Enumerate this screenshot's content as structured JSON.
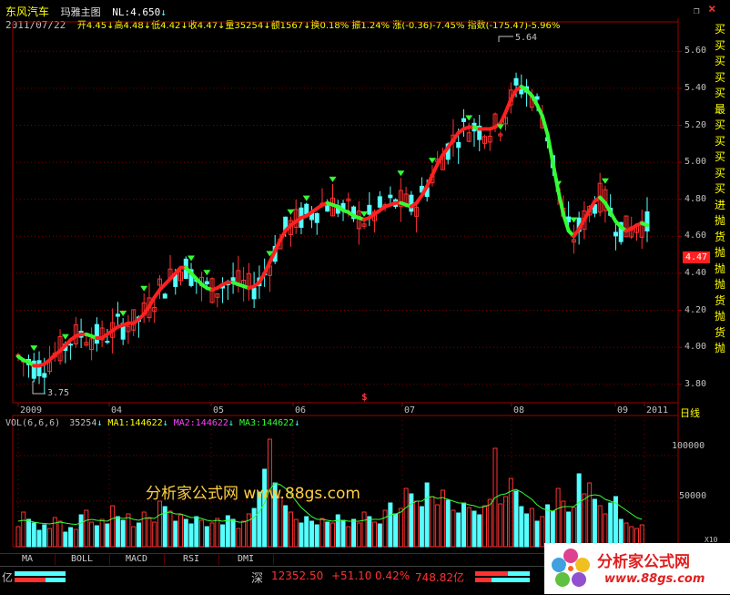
{
  "window": {
    "close_glyph": "×",
    "restore_glyph": "❐"
  },
  "header": {
    "stock_name": "东风汽车",
    "indicator_name": "玛雅主图",
    "nl_value": "NL:4.650",
    "date": "2011/07/22",
    "quote_line": "开4.45↓高4.48↓低4.42↓收4.47↓量35254↓额1567↓换0.18% 振1.24% 涨(-0.36)-7.45% 指数(-175.47)-5.96%"
  },
  "price_axis": {
    "ticks": [
      "5.60",
      "5.40",
      "5.20",
      "5.00",
      "4.80",
      "4.60",
      "4.40",
      "4.20",
      "4.00",
      "3.80"
    ],
    "current_price": "4.47"
  },
  "annotations": {
    "high_label": "5.64",
    "low_label": "3.75",
    "dollar_marker": "$"
  },
  "time_axis": {
    "labels": [
      "2009",
      "04",
      "05",
      "06",
      "07",
      "08",
      "09",
      "2011"
    ],
    "period_button": "日线"
  },
  "right_panel_text": "买买买买买最买买买买买进抛货抛抛抛货抛货抛",
  "volume_header": {
    "vol_label": "VOL(6,6,6)",
    "vol_value": "35254",
    "ma1": "MA1:144622",
    "ma2": "MA2:144622",
    "ma3": "MA3:144622"
  },
  "volume_axis": {
    "ticks": [
      "100000",
      "50000"
    ],
    "unit": "X10"
  },
  "watermark": {
    "text": "分析家公式网 www.88gs.com",
    "logo_cn": "分析家公式网",
    "logo_url": "www.88gs.com"
  },
  "tabs": [
    "MA",
    "BOLL",
    "MACD",
    "RSI",
    "DMI"
  ],
  "status_bar": {
    "left_label": "亿",
    "index_name": "深",
    "index_value": "12352.50",
    "index_change": "+51.10",
    "index_pct": "0.42%",
    "turnover": "748.82亿"
  },
  "colors": {
    "up": "#ff3232",
    "down": "#54ffff",
    "ma_up": "#ff2020",
    "ma_down": "#33ff33",
    "grid": "#800000",
    "text_yellow": "#ffff00",
    "text_cyan": "#54ffff",
    "text_magenta": "#ff44ff",
    "watermark": "#ffd040"
  },
  "chart_data": {
    "type": "candlestick",
    "ylim": [
      3.7,
      5.7
    ],
    "volume_ylim": [
      0,
      130000
    ],
    "ma_line": [
      3.95,
      3.93,
      3.92,
      3.9,
      3.9,
      3.91,
      3.93,
      3.96,
      3.98,
      4.01,
      4.04,
      4.06,
      4.07,
      4.07,
      4.06,
      4.05,
      4.05,
      4.07,
      4.09,
      4.11,
      4.12,
      4.13,
      4.13,
      4.15,
      4.18,
      4.22,
      4.27,
      4.31,
      4.34,
      4.37,
      4.4,
      4.43,
      4.43,
      4.4,
      4.37,
      4.34,
      4.32,
      4.31,
      4.32,
      4.34,
      4.35,
      4.35,
      4.34,
      4.33,
      4.32,
      4.33,
      4.35,
      4.4,
      4.46,
      4.52,
      4.58,
      4.63,
      4.66,
      4.68,
      4.7,
      4.71,
      4.73,
      4.75,
      4.77,
      4.78,
      4.77,
      4.76,
      4.74,
      4.73,
      4.71,
      4.7,
      4.69,
      4.7,
      4.72,
      4.74,
      4.76,
      4.77,
      4.78,
      4.78,
      4.77,
      4.76,
      4.78,
      4.82,
      4.87,
      4.93,
      4.99,
      5.04,
      5.08,
      5.12,
      5.16,
      5.18,
      5.19,
      5.19,
      5.18,
      5.18,
      5.18,
      5.19,
      5.21,
      5.27,
      5.34,
      5.39,
      5.41,
      5.39,
      5.36,
      5.31,
      5.25,
      5.15,
      5.0,
      4.85,
      4.72,
      4.63,
      4.6,
      4.64,
      4.69,
      4.74,
      4.79,
      4.81,
      4.78,
      4.73,
      4.68,
      4.65,
      4.63,
      4.64,
      4.66,
      4.67,
      4.66
    ],
    "volume": [
      22000,
      38000,
      30000,
      26000,
      18000,
      24000,
      20000,
      32000,
      28000,
      16000,
      21000,
      19000,
      35000,
      40000,
      27000,
      23000,
      30000,
      25000,
      45000,
      33000,
      29000,
      36000,
      22000,
      26000,
      38000,
      31000,
      27000,
      50000,
      44000,
      39000,
      28000,
      35000,
      30000,
      25000,
      33000,
      29000,
      22000,
      26000,
      31000,
      24000,
      34000,
      30000,
      20000,
      28000,
      36000,
      42000,
      60000,
      85000,
      118000,
      70000,
      54000,
      45000,
      38000,
      30000,
      26000,
      33000,
      28000,
      24000,
      31000,
      27000,
      26000,
      35000,
      29000,
      22000,
      30000,
      26000,
      38000,
      33000,
      27000,
      25000,
      40000,
      48000,
      36000,
      42000,
      64000,
      58000,
      50000,
      44000,
      70000,
      55000,
      46000,
      62000,
      51000,
      40000,
      37000,
      48000,
      43000,
      39000,
      35000,
      45000,
      52000,
      108000,
      47000,
      55000,
      75000,
      61000,
      44000,
      36000,
      42000,
      28000,
      33000,
      46000,
      39000,
      64000,
      50000,
      38000,
      43000,
      80000,
      58000,
      70000,
      52000,
      45000,
      36000,
      48000,
      55000,
      30000,
      26000,
      22000,
      20000,
      24000
    ],
    "volume_ma": [
      28000,
      29000,
      28500,
      27000,
      26000,
      25500,
      25000,
      26000,
      27000,
      26000,
      25000,
      24500,
      26000,
      29000,
      30000,
      29000,
      28500,
      28000,
      31000,
      32000,
      31000,
      32000,
      30000,
      29000,
      31000,
      32000,
      31000,
      35000,
      37000,
      38000,
      36000,
      36000,
      34000,
      32000,
      32000,
      31000,
      29000,
      28000,
      29000,
      28000,
      29000,
      29000,
      27000,
      27000,
      29000,
      32000,
      38000,
      48000,
      63000,
      70000,
      68000,
      64000,
      58000,
      50000,
      43000,
      38000,
      33000,
      30000,
      30000,
      29000,
      28000,
      29000,
      29000,
      28000,
      28000,
      28000,
      29000,
      30000,
      30000,
      30000,
      32000,
      35000,
      36000,
      38000,
      43000,
      47000,
      50000,
      50000,
      54000,
      55000,
      53000,
      54000,
      52000,
      50000,
      48000,
      48000,
      46000,
      45000,
      43000,
      44000,
      46000,
      54000,
      57000,
      58000,
      61000,
      63000,
      60000,
      56000,
      52000,
      46000,
      42000,
      40000,
      39000,
      42000,
      44000,
      44000,
      44000,
      49000,
      52000,
      56000,
      57000,
      56000,
      52000,
      50000,
      48000,
      44000,
      40000,
      36000,
      32000,
      30000
    ]
  }
}
